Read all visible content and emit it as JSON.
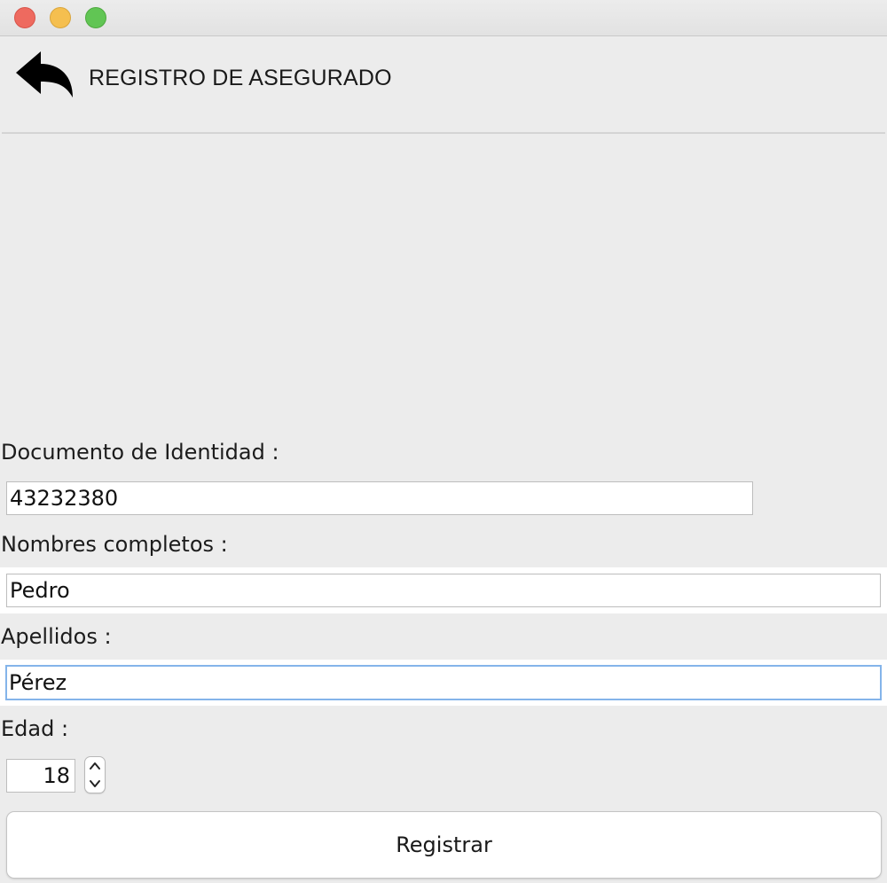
{
  "window": {
    "controls": [
      "close-button",
      "minimize-button",
      "maximize-button"
    ],
    "colors": {
      "close": "#ee6a5f",
      "minimize": "#f5bf4f",
      "maximize": "#61c554"
    }
  },
  "header": {
    "back_icon": "back-arrow-icon",
    "title": "REGISTRO DE ASEGURADO"
  },
  "form": {
    "documento": {
      "label": "Documento de Identidad :",
      "value": "43232380"
    },
    "nombres": {
      "label": "Nombres completos :",
      "value": "Pedro"
    },
    "apellidos": {
      "label": "Apellidos :",
      "value": "Pérez"
    },
    "edad": {
      "label": "Edad :",
      "value": "18"
    },
    "submit_label": "Registrar"
  },
  "colors": {
    "background": "#ececec",
    "focus_ring": "#84b4ea"
  }
}
